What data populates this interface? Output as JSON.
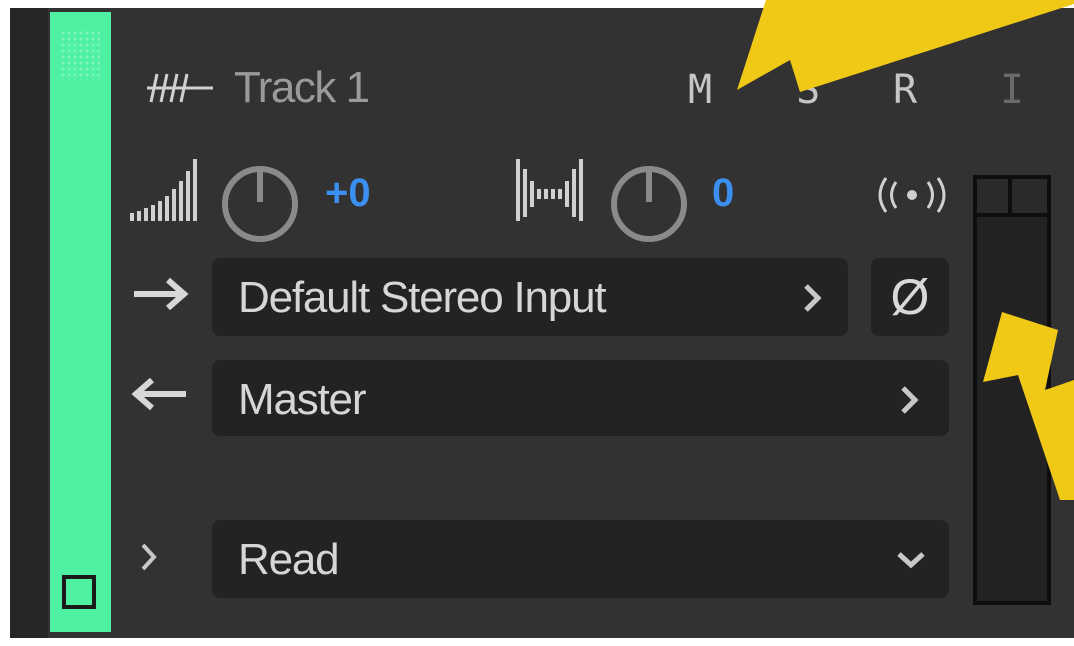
{
  "track": {
    "name": "Track 1",
    "color": "#4ef0a2",
    "mute_label": "M",
    "solo_label": "S",
    "record_label": "R",
    "input_monitor_label": "I"
  },
  "volume": {
    "value": "+0"
  },
  "pan": {
    "value": "0"
  },
  "input": {
    "label": "Default Stereo Input",
    "phase_invert_label": "Ø"
  },
  "output": {
    "label": "Master"
  },
  "automation": {
    "mode": "Read"
  },
  "colors": {
    "value_blue": "#3a8ff0",
    "panel": "#323232",
    "field": "#232323",
    "highlight_arrow": "#f0c816"
  },
  "icons": [
    "track-waveform-icon",
    "volume-icon",
    "volume-knob",
    "pan-icon",
    "pan-knob",
    "stereo-broadcast-icon",
    "input-arrow-icon",
    "output-arrow-icon",
    "expand-chevron-icon",
    "chevron-right-icon",
    "chevron-down-icon"
  ]
}
